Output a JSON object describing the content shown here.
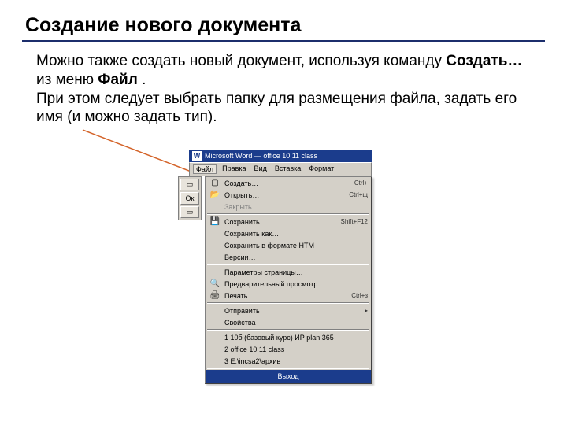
{
  "heading": "Создание нового документа",
  "para": {
    "seg1": "Можно также создать новый документ, используя команду ",
    "strong1": "Создать…",
    "seg2": " из меню ",
    "strong2": "Файл",
    "seg3": ".",
    "line2": "При этом следует выбрать папку для размещения файла, задать его имя (и можно задать тип)."
  },
  "shot": {
    "title": "Microsoft Word — office 10 11 class",
    "menubar": [
      "Файл",
      "Правка",
      "Вид",
      "Вставка",
      "Формат"
    ],
    "menu": [
      {
        "icon": "new-icon",
        "glyph": "▢",
        "label": "Создать…",
        "hotkey": "Ctrl+"
      },
      {
        "icon": "open-icon",
        "glyph": "📂",
        "label": "Открыть…",
        "hotkey": "Ctrl+щ"
      },
      {
        "icon": "",
        "glyph": "",
        "label": "Закрыть",
        "hotkey": "",
        "dim": true
      },
      {
        "sep": true
      },
      {
        "icon": "save-icon",
        "glyph": "💾",
        "label": "Сохранить",
        "hotkey": "Shift+F12"
      },
      {
        "icon": "",
        "glyph": "",
        "label": "Сохранить как…",
        "hotkey": ""
      },
      {
        "icon": "",
        "glyph": "",
        "label": "Сохранить в формате HTM",
        "hotkey": ""
      },
      {
        "icon": "",
        "glyph": "",
        "label": "Версии…",
        "hotkey": ""
      },
      {
        "sep": true
      },
      {
        "icon": "",
        "glyph": "",
        "label": "Параметры страницы…",
        "hotkey": ""
      },
      {
        "icon": "preview-icon",
        "glyph": "🔍",
        "label": "Предварительный просмотр",
        "hotkey": ""
      },
      {
        "icon": "print-icon",
        "glyph": "🖨",
        "label": "Печать…",
        "hotkey": "Ctrl+з"
      },
      {
        "sep": true
      },
      {
        "icon": "",
        "glyph": "",
        "label": "Отправить",
        "hotkey": "▸"
      },
      {
        "icon": "",
        "glyph": "",
        "label": "Свойства",
        "hotkey": ""
      },
      {
        "sep": true
      },
      {
        "icon": "",
        "glyph": "",
        "label": "1 10б (базовый курс) ИР plan 365",
        "hotkey": ""
      },
      {
        "icon": "",
        "glyph": "",
        "label": "2 office 10 11 class",
        "hotkey": ""
      },
      {
        "icon": "",
        "glyph": "",
        "label": "3 E:\\incsa2\\архив",
        "hotkey": ""
      },
      {
        "sep": true
      }
    ],
    "exit_label": "Выход"
  }
}
